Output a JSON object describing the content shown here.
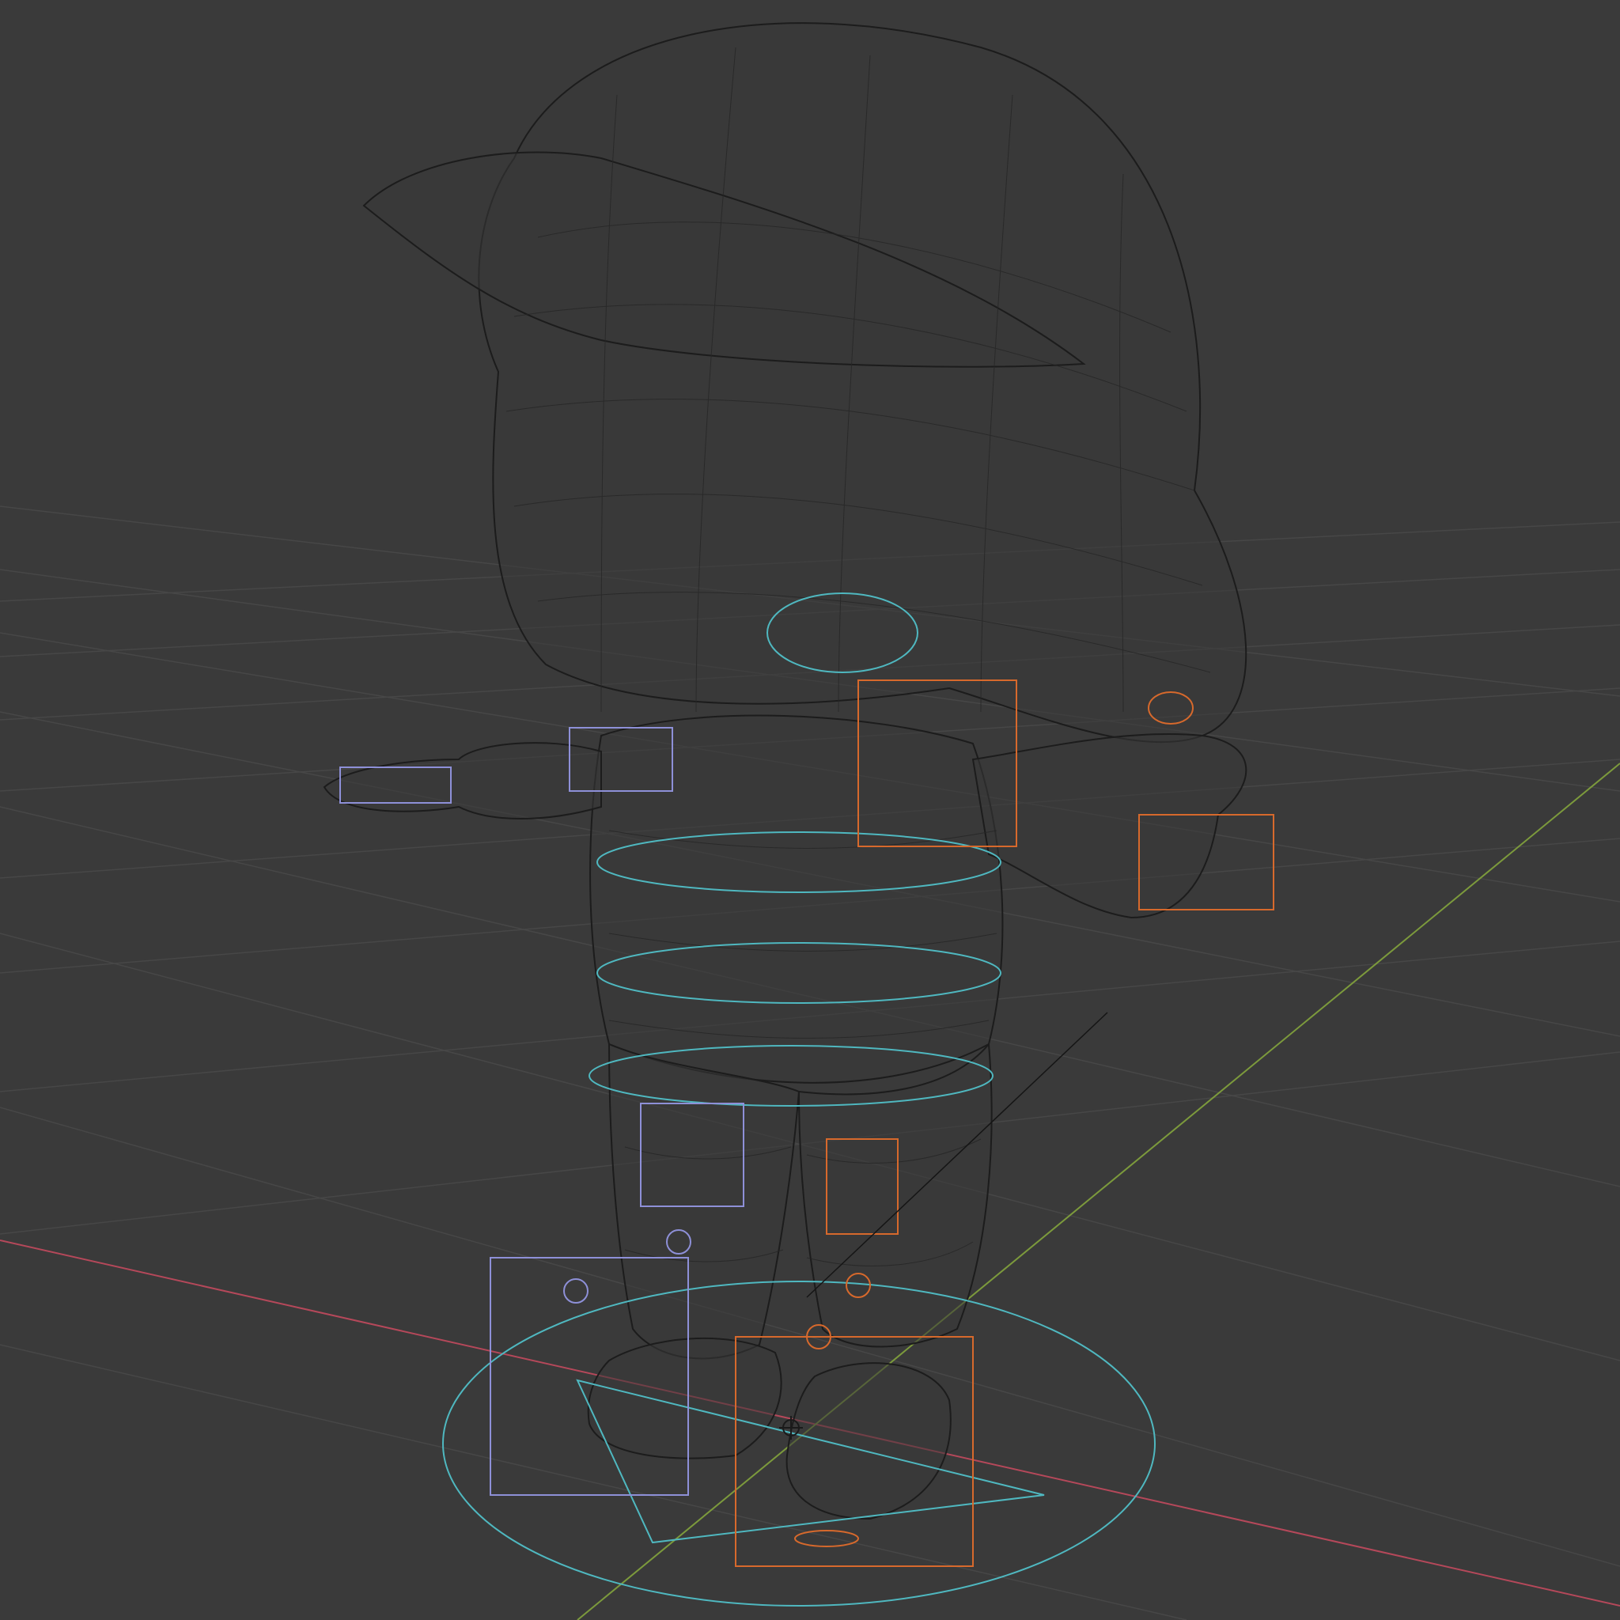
{
  "viewport": {
    "background": "#3a3a3a",
    "shading": "wireframe"
  },
  "colors": {
    "grid": "#474747",
    "x_axis": "#b5485a",
    "y_axis": "#7c9a3c",
    "mesh": "#1c1c1c",
    "control_cyan": "#4fb8c0",
    "control_orange": "#d7692c",
    "control_lavender": "#8e90d8"
  },
  "scene": {
    "object": "cartoon-character-mesh",
    "rig": "armature-controls"
  }
}
